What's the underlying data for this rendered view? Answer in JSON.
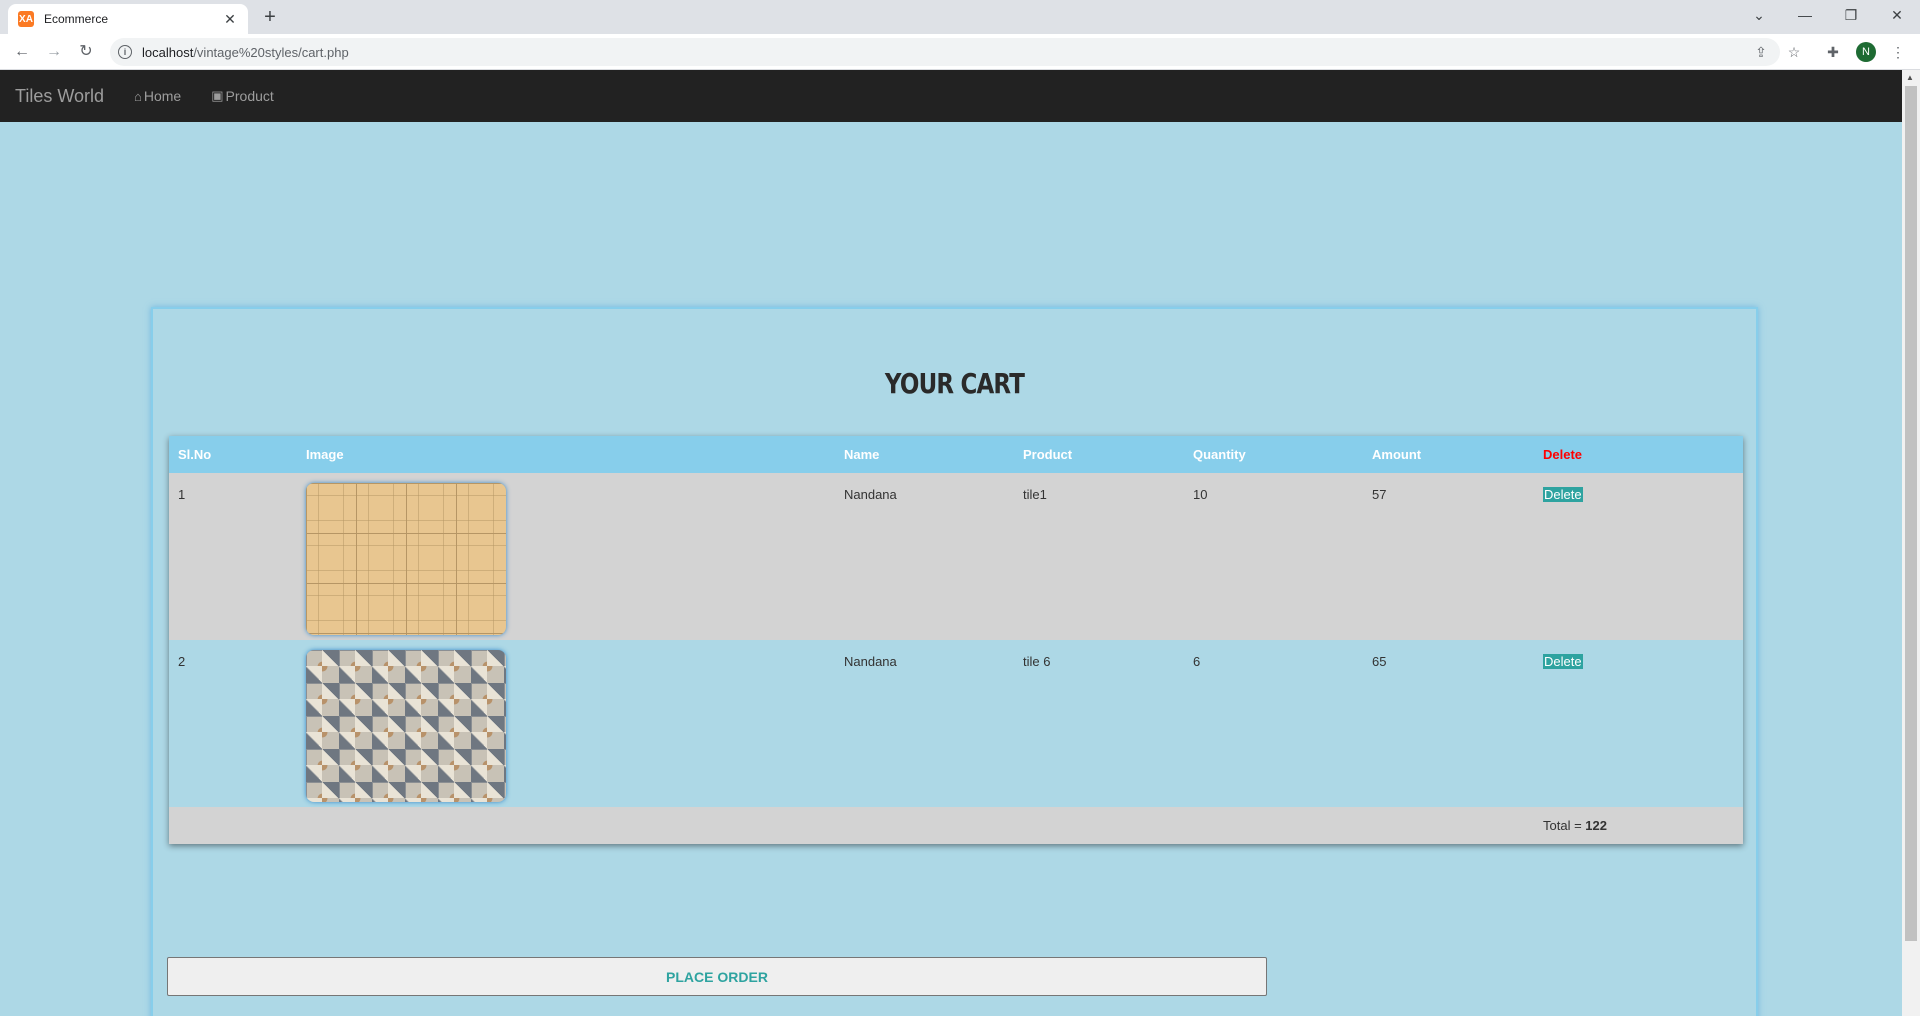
{
  "browser": {
    "tab_title": "Ecommerce",
    "favicon_text": "XA",
    "url_host": "localhost",
    "url_path": "/vintage%20styles/cart.php",
    "profile_initial": "N"
  },
  "navbar": {
    "brand": "Tiles World",
    "links": [
      {
        "label": "Home",
        "icon": "home-icon"
      },
      {
        "label": "Product",
        "icon": "product-icon"
      }
    ]
  },
  "cart": {
    "title": "YOUR CART",
    "headers": [
      "Sl.No",
      "Image",
      "Name",
      "Product",
      "Quantity",
      "Amount",
      "Delete"
    ],
    "rows": [
      {
        "sl_no": "1",
        "image": "beige-stone-tile",
        "name": "Nandana",
        "product": "tile1",
        "quantity": "10",
        "amount": "57",
        "delete_label": "Delete"
      },
      {
        "sl_no": "2",
        "image": "patterned-mosaic-tile",
        "name": "Nandana",
        "product": "tile 6",
        "quantity": "6",
        "amount": "65",
        "delete_label": "Delete"
      }
    ],
    "total_label": "Total = ",
    "total_value": "122",
    "place_order_label": "PLACE ORDER"
  },
  "colors": {
    "page_bg": "#add8e6",
    "header_bg": "#87ceeb",
    "navbar_bg": "#222222",
    "accent": "#2ea3a0",
    "delete_header": "#ff0000"
  }
}
